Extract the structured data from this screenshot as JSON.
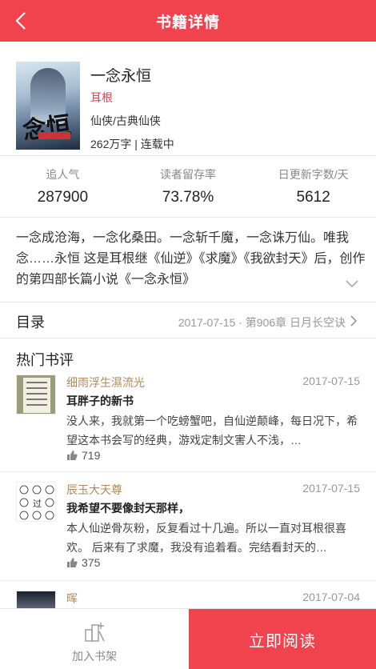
{
  "header": {
    "title": "书籍详情"
  },
  "book": {
    "name": "一念永恒",
    "author": "耳根",
    "genre": "仙侠/古典仙侠",
    "word_count": "262万字",
    "status": "连载中",
    "cover_text": "一念永恒"
  },
  "stats": [
    {
      "label": "追人气",
      "value": "287900"
    },
    {
      "label": "读者留存率",
      "value": "73.78%"
    },
    {
      "label": "日更新字数/天",
      "value": "5612"
    }
  ],
  "description": "一念成沧海，一念化桑田。一念斩千魔，一念诛万仙。唯我念……永恒 这是耳根继《仙逆》《求魔》《我欲封天》后，创作的第四部长篇小说《一念永恒》",
  "toc": {
    "label": "目录",
    "latest": "2017-07-15 · 第906章 日月长空诀"
  },
  "hot_reviews": {
    "title": "热门书评",
    "items": [
      {
        "user": "细雨浮生濕流光",
        "date": "2017-07-15",
        "title": "耳胖子的新书",
        "body": "没人来，我就第一个吃螃蟹吧，自仙逆颠峰，每日况下，希望这本书会写的经典，游戏定制文害人不浅，…",
        "likes": "719"
      },
      {
        "user": "辰玉大天尊",
        "date": "2017-07-15",
        "title": "我希望不要像封天那样，",
        "body": "本人仙逆骨灰粉，反复看过十几遍。所以一直对耳根很喜欢。 后来有了求魔，我没有追着看。完结看封天的…",
        "likes": "375"
      },
      {
        "user": "晖",
        "date": "2017-07-04",
        "title": "",
        "body": "",
        "likes": ""
      }
    ]
  },
  "footer": {
    "shelf_label": "加入书架",
    "read_label": "立即阅读"
  },
  "colors": {
    "accent": "#f0434e",
    "author": "#e0424c",
    "reviewer": "#b08a5a"
  }
}
